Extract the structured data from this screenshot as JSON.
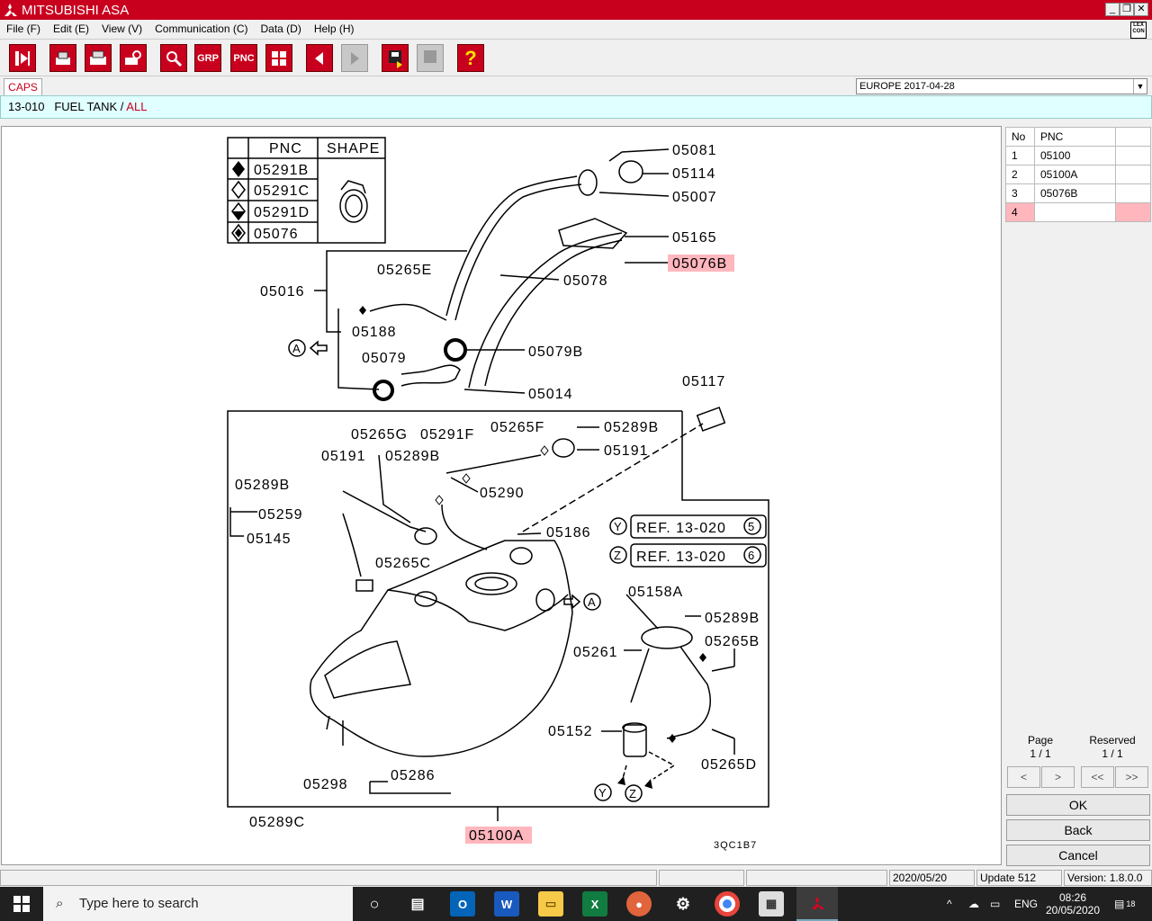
{
  "window": {
    "title": "MITSUBISHI ASA",
    "min_label": "_",
    "max_label": "❐",
    "close_label": "✕",
    "lexcon_top": "LEX",
    "lexcon_bottom": "CON"
  },
  "menu": [
    "File (F)",
    "Edit (E)",
    "View (V)",
    "Communication (C)",
    "Data (D)",
    "Help (H)"
  ],
  "toolbar": {
    "grp_label": "GRP",
    "pnc_label": "PNC",
    "help_label": "?"
  },
  "tabs": {
    "caps": "CAPS"
  },
  "region": {
    "value": "EUROPE   2017-04-28"
  },
  "path": {
    "code": "13-010",
    "name": "FUEL TANK",
    "sep": " / ",
    "filter": "ALL"
  },
  "diagram": {
    "legend_headers": {
      "pnc": "PNC",
      "shape": "SHAPE"
    },
    "legend_rows": [
      "05291B",
      "05291C",
      "05291D",
      "05076"
    ],
    "labels": {
      "l05081": "05081",
      "l05114": "05114",
      "l05007": "05007",
      "l05165": "05165",
      "l05076B": "05076B",
      "l05078": "05078",
      "l05265E": "05265E",
      "l05016": "05016",
      "l05188": "05188",
      "l05079B": "05079B",
      "l05079": "05079",
      "l05014": "05014",
      "lA1": "A",
      "l05117": "05117",
      "l05265G": "05265G",
      "l05291F": "05291F",
      "l05265F": "05265F",
      "l05289B1": "05289B",
      "l05191a": "05191",
      "l05289B2": "05289B",
      "l05191b": "05191",
      "l05289B3": "05289B",
      "l05290": "05290",
      "l05259": "05259",
      "l05145": "05145",
      "l05186": "05186",
      "l05265C": "05265C",
      "lY": "Y",
      "lZ": "Z",
      "ref1": "REF. 13-020",
      "ref1n": "5",
      "ref2": "REF. 13-020",
      "ref2n": "6",
      "lA2": "A",
      "l05158A": "05158A",
      "l05289B4": "05289B",
      "l05261": "05261",
      "l05265B": "05265B",
      "l05152": "05152",
      "l05265D": "05265D",
      "l05286": "05286",
      "l05298": "05298",
      "l05289C": "05289C",
      "l05100A": "05100A",
      "lY2": "Y",
      "lZ2": "Z",
      "code": "3QC1B7"
    }
  },
  "pnc_table": {
    "headers": [
      "No",
      "PNC"
    ],
    "rows": [
      {
        "no": "1",
        "pnc": "05100"
      },
      {
        "no": "2",
        "pnc": "05100A"
      },
      {
        "no": "3",
        "pnc": "05076B"
      },
      {
        "no": "4",
        "pnc": ""
      }
    ]
  },
  "pager": {
    "page_label": "Page",
    "page_value": "1 / 1",
    "reserved_label": "Reserved",
    "reserved_value": "1 / 1",
    "prev": "<",
    "next": ">",
    "first": "<<",
    "last": ">>"
  },
  "actions": {
    "ok": "OK",
    "back": "Back",
    "cancel": "Cancel"
  },
  "status": {
    "date": "2020/05/20",
    "update": "Update 512",
    "version": "Version: 1.8.0.0"
  },
  "taskbar": {
    "search_placeholder": "Type here to search",
    "lang": "ENG",
    "time": "08:26",
    "date": "20/05/2020",
    "notif": "18"
  },
  "colors": {
    "brand": "#c8001e",
    "highlight": "#ffb6bd",
    "path_bg": "#e0ffff"
  }
}
